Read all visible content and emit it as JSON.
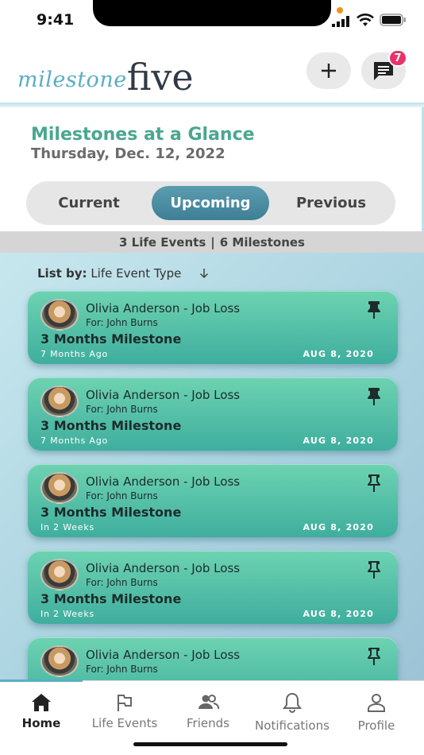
{
  "status_bar": {
    "time": "9:41"
  },
  "header": {
    "logo_part1": "milestone",
    "logo_part2": "five",
    "message_badge": "7"
  },
  "glance": {
    "title": "Milestones at a Glance",
    "date": "Thursday, Dec. 12, 2022",
    "tabs": [
      "Current",
      "Upcoming",
      "Previous"
    ],
    "selected_tab": "Upcoming"
  },
  "summary": {
    "life_events": "3 Life Events",
    "separator": "|",
    "milestones": "6 Milestones"
  },
  "list": {
    "sort_label": "List by:",
    "sort_value": "Life Event Type",
    "sort_icon": "arrow-down-icon",
    "cards": [
      {
        "name": "Olivia Anderson - Job Loss",
        "for": "For: John Burns",
        "milestone": "3 Months Milestone",
        "relative": "7 Months Ago",
        "date": "AUG 8, 2020",
        "pinned": true
      },
      {
        "name": "Olivia Anderson - Job Loss",
        "for": "For: John Burns",
        "milestone": "3 Months Milestone",
        "relative": "7 Months Ago",
        "date": "AUG 8, 2020",
        "pinned": true
      },
      {
        "name": "Olivia Anderson - Job Loss",
        "for": "For: John Burns",
        "milestone": "3 Months Milestone",
        "relative": "In 2 Weeks",
        "date": "AUG 8, 2020",
        "pinned": false
      },
      {
        "name": "Olivia Anderson - Job Loss",
        "for": "For: John Burns",
        "milestone": "3 Months Milestone",
        "relative": "In 2 Weeks",
        "date": "AUG 8, 2020",
        "pinned": false
      },
      {
        "name": "Olivia Anderson - Job Loss",
        "for": "For: John Burns",
        "milestone": "",
        "relative": "",
        "date": "",
        "pinned": false
      }
    ]
  },
  "tabbar": {
    "items": [
      {
        "label": "Home",
        "icon": "home-icon",
        "active": true
      },
      {
        "label": "Life Events",
        "icon": "flag-icon",
        "active": false
      },
      {
        "label": "Friends",
        "icon": "friends-icon",
        "active": false
      },
      {
        "label": "Notifications",
        "icon": "bell-icon",
        "active": false
      },
      {
        "label": "Profile",
        "icon": "profile-icon",
        "active": false
      }
    ]
  },
  "colors": {
    "accent": "#4aa78f",
    "brand_blue": "#5aaec4",
    "badge": "#e8336a",
    "card_top": "#6dd3b1",
    "card_bottom": "#3fae9e"
  }
}
